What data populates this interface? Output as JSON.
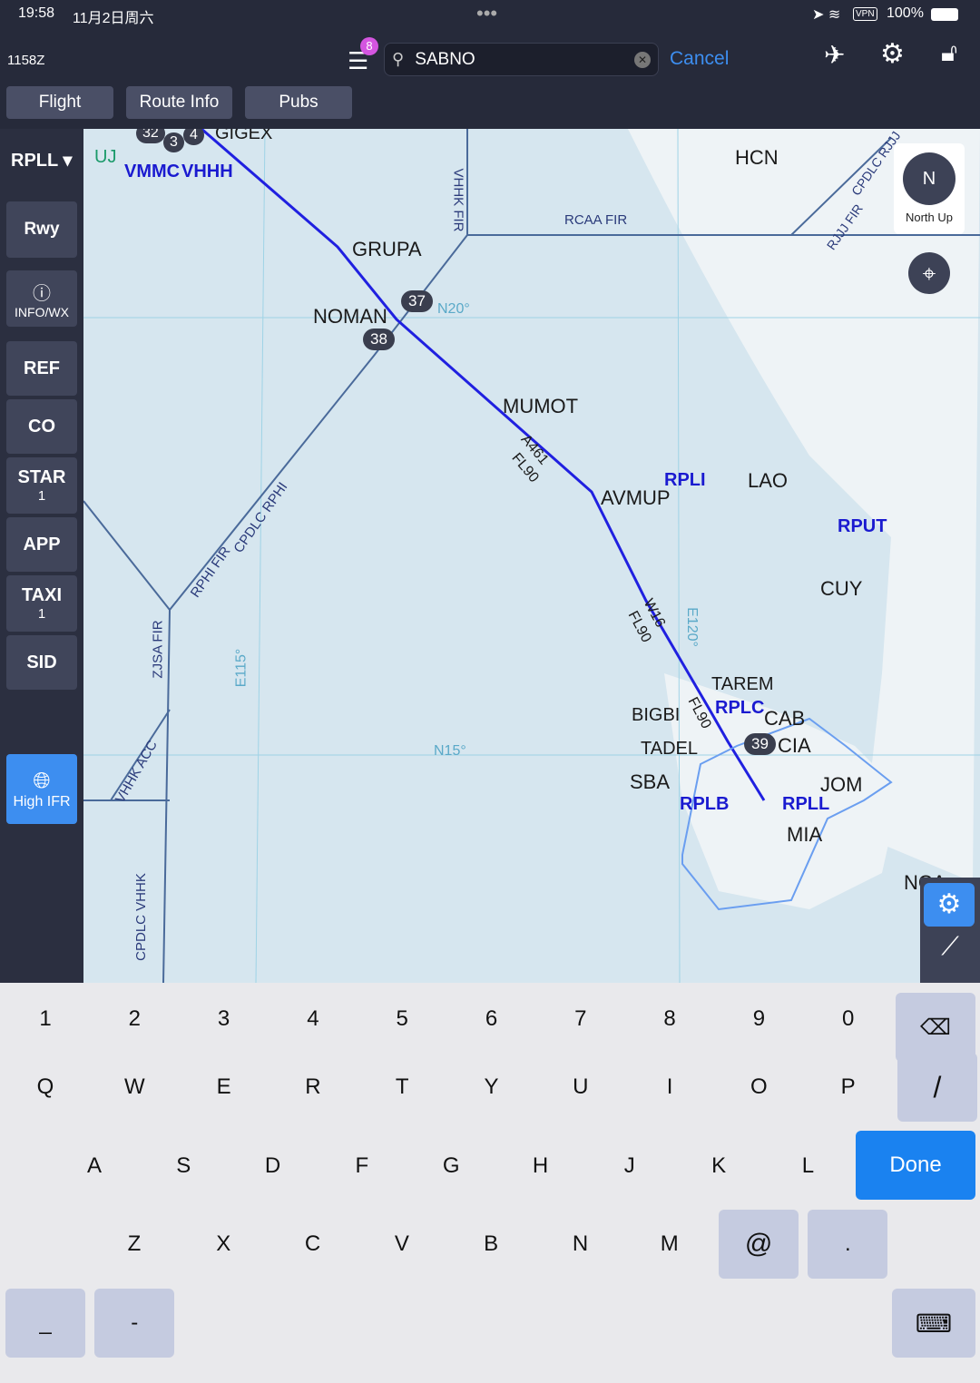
{
  "status": {
    "time": "19:58",
    "date": "11月2日周六",
    "vpn": "VPN",
    "battery": "100%"
  },
  "header": {
    "zulu": "1158Z",
    "badge": "8",
    "search_value": "SABNO",
    "cancel": "Cancel"
  },
  "tabs": [
    "Flight",
    "Route Info",
    "Pubs"
  ],
  "sidebar": {
    "airport": "RPLL",
    "rwy": "Rwy",
    "info": "INFO/WX",
    "ref": "REF",
    "co": "CO",
    "star": "STAR",
    "star_count": "1",
    "app": "APP",
    "taxi": "TAXI",
    "taxi_count": "1",
    "sid": "SID",
    "layer": "High IFR"
  },
  "compass": {
    "label": "N",
    "mode": "North Up"
  },
  "map": {
    "waypoints": [
      "GRUPA",
      "NOMAN",
      "MUMOT",
      "AVMUP",
      "TAREM",
      "BIGBI",
      "TADEL",
      "SBA",
      "MIA",
      "LAO",
      "HCN",
      "CUY",
      "CAB",
      "CIA",
      "JOM",
      "GIGEX",
      "NCA"
    ],
    "airports": [
      "VMMC",
      "VHHH",
      "RPLI",
      "RPUT",
      "RPLC",
      "RPLB",
      "RPLL",
      "UJ"
    ],
    "airways": [
      "A461",
      "FL90",
      "W16",
      "FL90",
      "FL90"
    ],
    "fir": [
      "RCAA FIR",
      "VHHK FIR",
      "RPHI FIR",
      "CPDLC RPHI",
      "ZJSA FIR",
      "VHHK ACC",
      "CPDLC VHHK",
      "RJJJ FIR",
      "CPDLC RJJJ"
    ],
    "grid": [
      "N20°",
      "N15°",
      "E115°",
      "E120°"
    ],
    "mea": [
      "32",
      "3",
      "4",
      "37",
      "38",
      "39"
    ]
  },
  "keyboard": {
    "row1": [
      "1",
      "2",
      "3",
      "4",
      "5",
      "6",
      "7",
      "8",
      "9",
      "0"
    ],
    "row2": [
      "Q",
      "W",
      "E",
      "R",
      "T",
      "Y",
      "U",
      "I",
      "O",
      "P",
      "/"
    ],
    "row3": [
      "A",
      "S",
      "D",
      "F",
      "G",
      "H",
      "J",
      "K",
      "L"
    ],
    "done": "Done",
    "row4": [
      "Z",
      "X",
      "C",
      "V",
      "B",
      "N",
      "M",
      "@",
      "."
    ],
    "row5": [
      "_",
      "-"
    ]
  },
  "colors": {
    "route": "#2020e0",
    "airport": "#1a1ad0",
    "accent": "#3d8ef0",
    "map": "#d6e6ef"
  }
}
